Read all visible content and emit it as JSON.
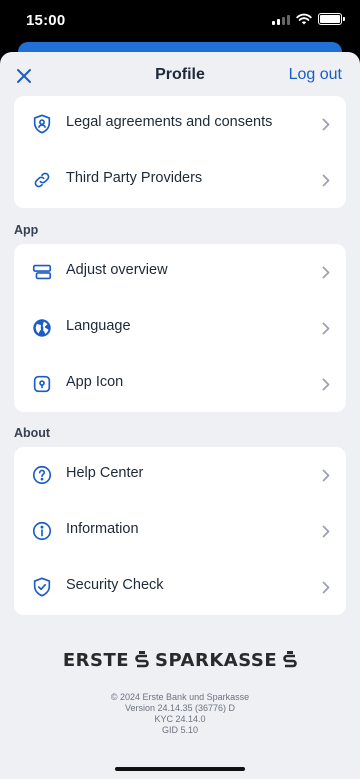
{
  "status": {
    "time": "15:00"
  },
  "header": {
    "title": "Profile",
    "logout_label": "Log out"
  },
  "sections": {
    "top": [
      {
        "label": "Legal agreements and consents",
        "icon": "shield-person-icon"
      },
      {
        "label": "Third Party Providers",
        "icon": "link-icon"
      }
    ],
    "app": {
      "title": "App",
      "items": [
        {
          "label": "Adjust overview",
          "icon": "layout-icon"
        },
        {
          "label": "Language",
          "icon": "globe-icon"
        },
        {
          "label": "App Icon",
          "icon": "app-icon-icon"
        }
      ]
    },
    "about": {
      "title": "About",
      "items": [
        {
          "label": "Help Center",
          "icon": "question-icon"
        },
        {
          "label": "Information",
          "icon": "info-icon"
        },
        {
          "label": "Security Check",
          "icon": "shield-check-icon"
        }
      ]
    }
  },
  "footer": {
    "logo_left": "ERSTE",
    "logo_right": "SPARKASSE",
    "copyright": "© 2024 Erste Bank und Sparkasse",
    "version": "Version 24.14.35 (36776) D",
    "kyc": "KYC 24.14.0",
    "gid": "GID 5.10"
  },
  "colors": {
    "accent": "#1b5cc7",
    "background": "#eef0f4",
    "card": "#ffffff",
    "text": "#1f2937"
  }
}
